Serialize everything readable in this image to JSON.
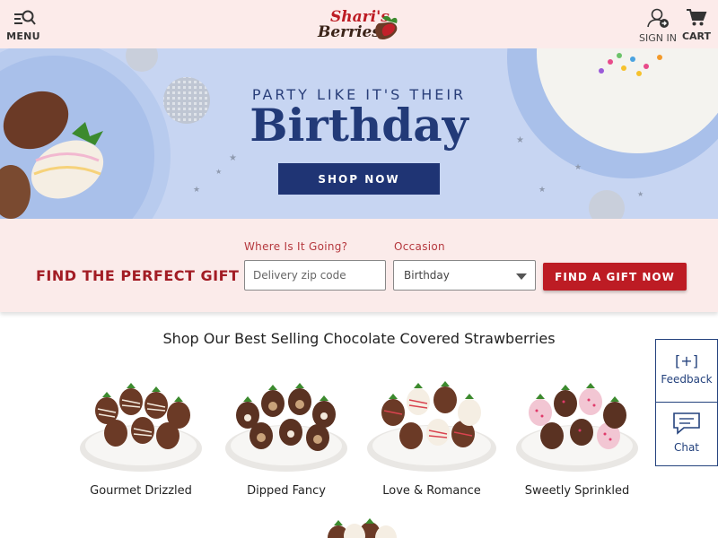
{
  "header": {
    "menu_label": "MENU",
    "logo_text_line1": "Shari's",
    "logo_text_line2": "Berries",
    "signin_label": "SIGN IN",
    "cart_label": "CART"
  },
  "hero": {
    "line1": "PARTY LIKE IT'S THEIR",
    "line2": "Birthday",
    "button_label": "SHOP NOW"
  },
  "finder": {
    "title": "FIND THE PERFECT GIFT",
    "zip_label": "Where Is It Going?",
    "zip_placeholder": "Delivery zip code",
    "zip_value": "",
    "occasion_label": "Occasion",
    "occasion_value": "Birthday",
    "button_label": "FIND A GIFT NOW"
  },
  "products": {
    "title": "Shop Our Best Selling Chocolate Covered Strawberries",
    "items": [
      {
        "label": "Gourmet Drizzled"
      },
      {
        "label": "Dipped Fancy"
      },
      {
        "label": "Love & Romance"
      },
      {
        "label": "Sweetly Sprinkled"
      }
    ]
  },
  "side": {
    "feedback_icon": "[+]",
    "feedback_label": "Feedback",
    "chat_label": "Chat"
  },
  "colors": {
    "header_bg": "#fcebea",
    "brand_red": "#bd1c24",
    "hero_bg": "#c7d5f2",
    "hero_navy": "#1f3474"
  }
}
